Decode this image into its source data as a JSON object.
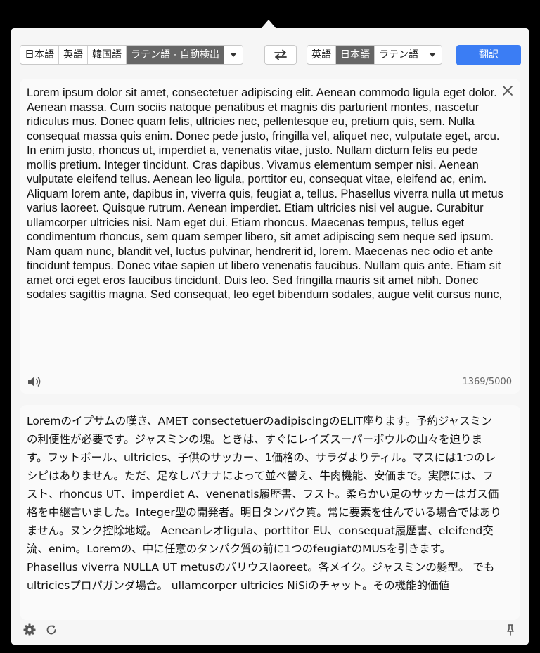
{
  "source_languages": {
    "options": [
      "日本語",
      "英語",
      "韓国語",
      "ラテン語 - 自動検出"
    ],
    "selected_index": 3
  },
  "target_languages": {
    "options": [
      "英語",
      "日本語",
      "ラテン語"
    ],
    "selected_index": 1
  },
  "translate_button": "翻訳",
  "source": {
    "text": "Lorem ipsum dolor sit amet, consectetuer adipiscing elit. Aenean commodo ligula eget dolor. Aenean massa. Cum sociis natoque penatibus et magnis dis parturient montes, nascetur ridiculus mus. Donec quam felis, ultricies nec, pellentesque eu, pretium quis, sem. Nulla consequat massa quis enim. Donec pede justo, fringilla vel, aliquet nec, vulputate eget, arcu. In enim justo, rhoncus ut, imperdiet a, venenatis vitae, justo. Nullam dictum felis eu pede mollis pretium. Integer tincidunt. Cras dapibus. Vivamus elementum semper nisi. Aenean vulputate eleifend tellus. Aenean leo ligula, porttitor eu, consequat vitae, eleifend ac, enim. Aliquam lorem ante, dapibus in, viverra quis, feugiat a, tellus. Phasellus viverra nulla ut metus varius laoreet. Quisque rutrum. Aenean imperdiet. Etiam ultricies nisi vel augue. Curabitur ullamcorper ultricies nisi. Nam eget dui. Etiam rhoncus. Maecenas tempus, tellus eget condimentum rhoncus, sem quam semper libero, sit amet adipiscing sem neque sed ipsum. Nam quam nunc, blandit vel, luctus pulvinar, hendrerit id, lorem. Maecenas nec odio et ante tincidunt tempus. Donec vitae sapien ut libero venenatis faucibus. Nullam quis ante. Etiam sit amet orci eget eros faucibus tincidunt. Duis leo. Sed fringilla mauris sit amet nibh. Donec sodales sagittis magna. Sed consequat, leo eget bibendum sodales, augue velit cursus nunc,",
    "char_count": "1369/5000"
  },
  "output": {
    "text": "Loremのイプサムの嘆き、AMET consectetuerのadipiscingのELIT座ります。予約ジャスミンの利便性が必要です。ジャスミンの塊。ときは、すぐにレイズスーパーボウルの山々を迫ります。フットボール、ultricies、子供のサッカー、1価格の、サラダよりティル。マスには1つのレシピはありません。ただ、足なしバナナによって並べ替え、牛肉機能、安価まで。実際には、フスト、rhoncus UT、imperdiet A、venenatis履歴書、フスト。柔らかい足のサッカーはガス価格を中継言いました。Integer型の開発者。明日タンパク質。常に要素を住んでいる場合ではありません。ヌンク控除地域。 Aeneanレオligula、porttitor EU、consequat履歴書、eleifend交流、enim。Loremの、中に任意のタンパク質の前に1つのfeugiatのMUSを引きます。 Phasellus viverra NULLA UT metusのバリウスlaoreet。各メイク。ジャスミンの髪型。 でもultriciesプロパガンダ場合。 ullamcorper ultricies NiSiのチャット。その機能的価値"
  },
  "colors": {
    "accent": "#3b7df4",
    "active_segment": "#666666",
    "panel": "#f6f6f6"
  },
  "icons": [
    "swap-icon",
    "close-icon",
    "speaker-icon",
    "settings-icon",
    "refresh-icon",
    "pin-icon"
  ]
}
